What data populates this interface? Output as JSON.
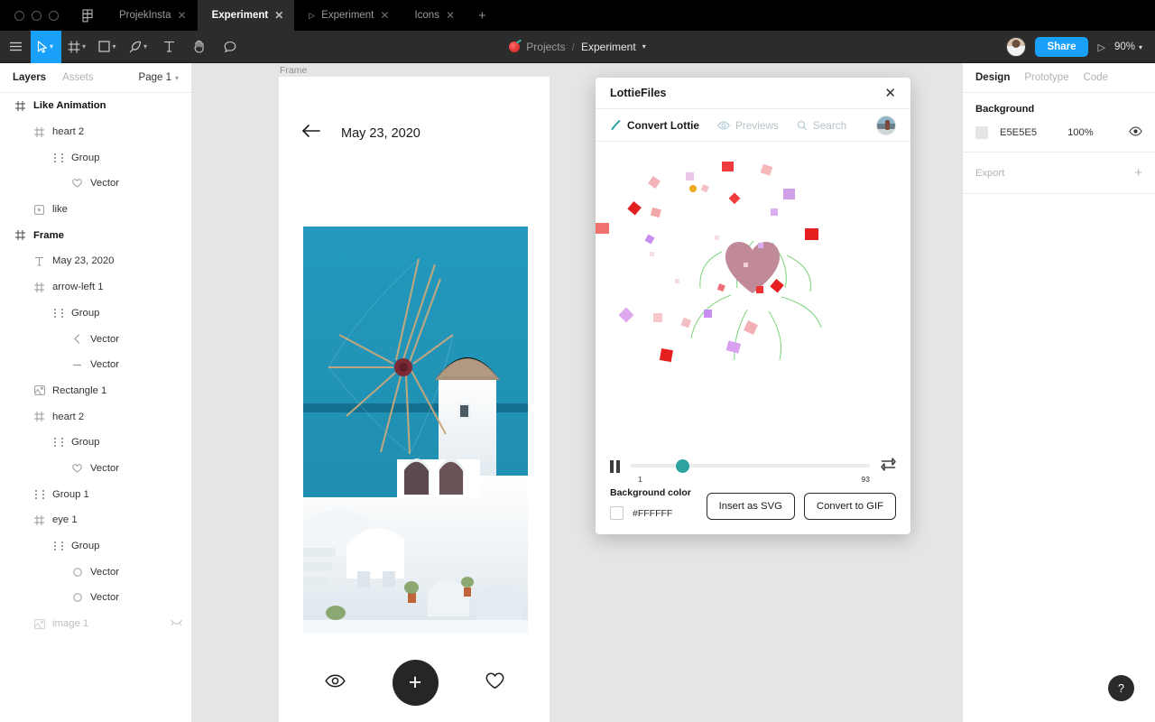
{
  "window": {
    "tabs": [
      {
        "label": "ProjekInsta",
        "active": false,
        "prototype": false
      },
      {
        "label": "Experiment",
        "active": true,
        "prototype": false
      },
      {
        "label": "Experiment",
        "active": false,
        "prototype": true
      },
      {
        "label": "Icons",
        "active": false,
        "prototype": false
      }
    ],
    "add_tab": "+"
  },
  "toolbar": {
    "menu_icon": "hamburger-icon",
    "tools": [
      "move-tool",
      "frame-tool",
      "shape-tool",
      "pen-tool",
      "text-tool",
      "hand-tool",
      "comment-tool"
    ],
    "breadcrumb": {
      "project": "Projects",
      "separator": "/",
      "file": "Experiment"
    },
    "share_label": "Share",
    "zoom_level": "90%"
  },
  "left_panel": {
    "tabs": [
      {
        "label": "Layers",
        "active": true
      },
      {
        "label": "Assets",
        "active": false
      }
    ],
    "page": "Page 1",
    "layers": [
      {
        "name": "Like Animation",
        "icon": "frame-icon",
        "indent": 0,
        "bold": true,
        "hidden": false
      },
      {
        "name": "heart 2",
        "icon": "frame-icon",
        "indent": 1,
        "bold": false,
        "hidden": false
      },
      {
        "name": "Group",
        "icon": "group-icon",
        "indent": 2,
        "bold": false,
        "hidden": false
      },
      {
        "name": "Vector",
        "icon": "heart-icon",
        "indent": 3,
        "bold": false,
        "hidden": false
      },
      {
        "name": "like",
        "icon": "component-icon",
        "indent": 1,
        "bold": false,
        "hidden": false
      },
      {
        "name": "Frame",
        "icon": "frame-icon",
        "indent": 0,
        "bold": true,
        "hidden": false
      },
      {
        "name": "May 23, 2020",
        "icon": "text-icon",
        "indent": 1,
        "bold": false,
        "hidden": false
      },
      {
        "name": "arrow-left 1",
        "icon": "frame-icon",
        "indent": 1,
        "bold": false,
        "hidden": false
      },
      {
        "name": "Group",
        "icon": "group-icon",
        "indent": 2,
        "bold": false,
        "hidden": false
      },
      {
        "name": "Vector",
        "icon": "chevron-left-icon",
        "indent": 3,
        "bold": false,
        "hidden": false
      },
      {
        "name": "Vector",
        "icon": "line-icon",
        "indent": 3,
        "bold": false,
        "hidden": false
      },
      {
        "name": "Rectangle 1",
        "icon": "image-icon",
        "indent": 1,
        "bold": false,
        "hidden": false
      },
      {
        "name": "heart 2",
        "icon": "frame-icon",
        "indent": 1,
        "bold": false,
        "hidden": false
      },
      {
        "name": "Group",
        "icon": "group-icon",
        "indent": 2,
        "bold": false,
        "hidden": false
      },
      {
        "name": "Vector",
        "icon": "heart-icon",
        "indent": 3,
        "bold": false,
        "hidden": false
      },
      {
        "name": "Group 1",
        "icon": "group-icon",
        "indent": 1,
        "bold": false,
        "hidden": false
      },
      {
        "name": "eye 1",
        "icon": "frame-icon",
        "indent": 1,
        "bold": false,
        "hidden": false
      },
      {
        "name": "Group",
        "icon": "group-icon",
        "indent": 2,
        "bold": false,
        "hidden": false
      },
      {
        "name": "Vector",
        "icon": "ellipse-icon",
        "indent": 3,
        "bold": false,
        "hidden": false
      },
      {
        "name": "Vector",
        "icon": "ellipse-icon",
        "indent": 3,
        "bold": false,
        "hidden": false
      },
      {
        "name": "image 1",
        "icon": "image-icon",
        "indent": 1,
        "bold": false,
        "hidden": true
      }
    ]
  },
  "canvas": {
    "frame_label": "Frame",
    "phone": {
      "back_icon": "arrow-left-icon",
      "date": "May 23, 2020",
      "photo_alt": "santorini-windmill-photo",
      "actions": [
        {
          "icon": "eye-icon",
          "label": "view"
        },
        {
          "icon": "plus-icon",
          "label": "add"
        },
        {
          "icon": "heart-icon",
          "label": "like"
        }
      ],
      "fab_label": "+"
    }
  },
  "plugin": {
    "title": "LottieFiles",
    "close_icon": "close-icon",
    "tabs": [
      {
        "label": "Convert Lottie",
        "icon": "lottie-icon",
        "active": true
      },
      {
        "label": "Previews",
        "icon": "eye-icon",
        "active": false
      },
      {
        "label": "Search",
        "icon": "search-icon",
        "active": false
      }
    ],
    "avatar": "user-avatar",
    "animation": "heart-confetti-burst",
    "player": {
      "play_state": "pause",
      "frame_min": "1",
      "frame_max": "93",
      "progress_percent": 19,
      "loop_icon": "loop-icon"
    },
    "background_color_label": "Background color",
    "background_color_value": "#FFFFFF",
    "buttons": [
      {
        "label": "Insert as SVG"
      },
      {
        "label": "Convert to GIF"
      }
    ]
  },
  "right_panel": {
    "tabs": [
      {
        "label": "Design",
        "active": true
      },
      {
        "label": "Prototype",
        "active": false
      },
      {
        "label": "Code",
        "active": false
      }
    ],
    "background": {
      "heading": "Background",
      "color_hex": "E5E5E5",
      "opacity": "100%",
      "visibility_icon": "eye-icon"
    },
    "export": {
      "heading": "Export",
      "add_icon": "plus-icon"
    }
  },
  "help": {
    "label": "?"
  },
  "colors": {
    "accent_blue": "#18a0fb",
    "lottie_teal": "#2ca3a0",
    "dark_chrome": "#2c2c2c",
    "canvas_gray": "#e5e5e5"
  }
}
